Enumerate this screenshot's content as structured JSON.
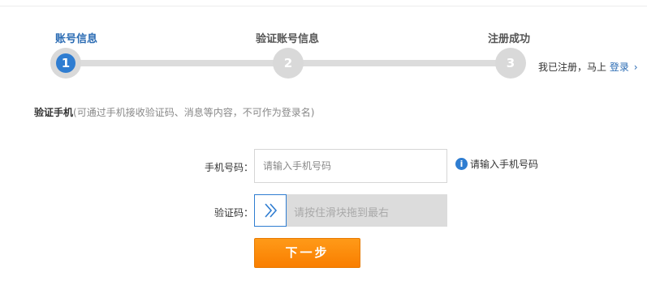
{
  "steps": [
    {
      "label": "账号信息",
      "number": "1",
      "state": "active"
    },
    {
      "label": "验证账号信息",
      "number": "2",
      "state": "inactive"
    },
    {
      "label": "注册成功",
      "number": "3",
      "state": "inactive"
    }
  ],
  "login_hint": {
    "text": "我已注册，马上",
    "link": "登录",
    "chevron": "›"
  },
  "section": {
    "title": "验证手机",
    "note": "(可通过手机接收验证码、消息等内容，不可作为登录名)"
  },
  "form": {
    "phone_label": "手机号码：",
    "phone_placeholder": "请输入手机号码",
    "phone_value": "",
    "tip_icon": "i",
    "tip_text": "请输入手机号码",
    "captcha_label": "验证码：",
    "slider_text": "请按住滑块拖到最右",
    "slider_progress": 0
  },
  "buttons": {
    "next": "下一步"
  },
  "colors": {
    "accent": "#2f7dd1",
    "button": "#f98d0b",
    "link": "#2a6bb3"
  }
}
